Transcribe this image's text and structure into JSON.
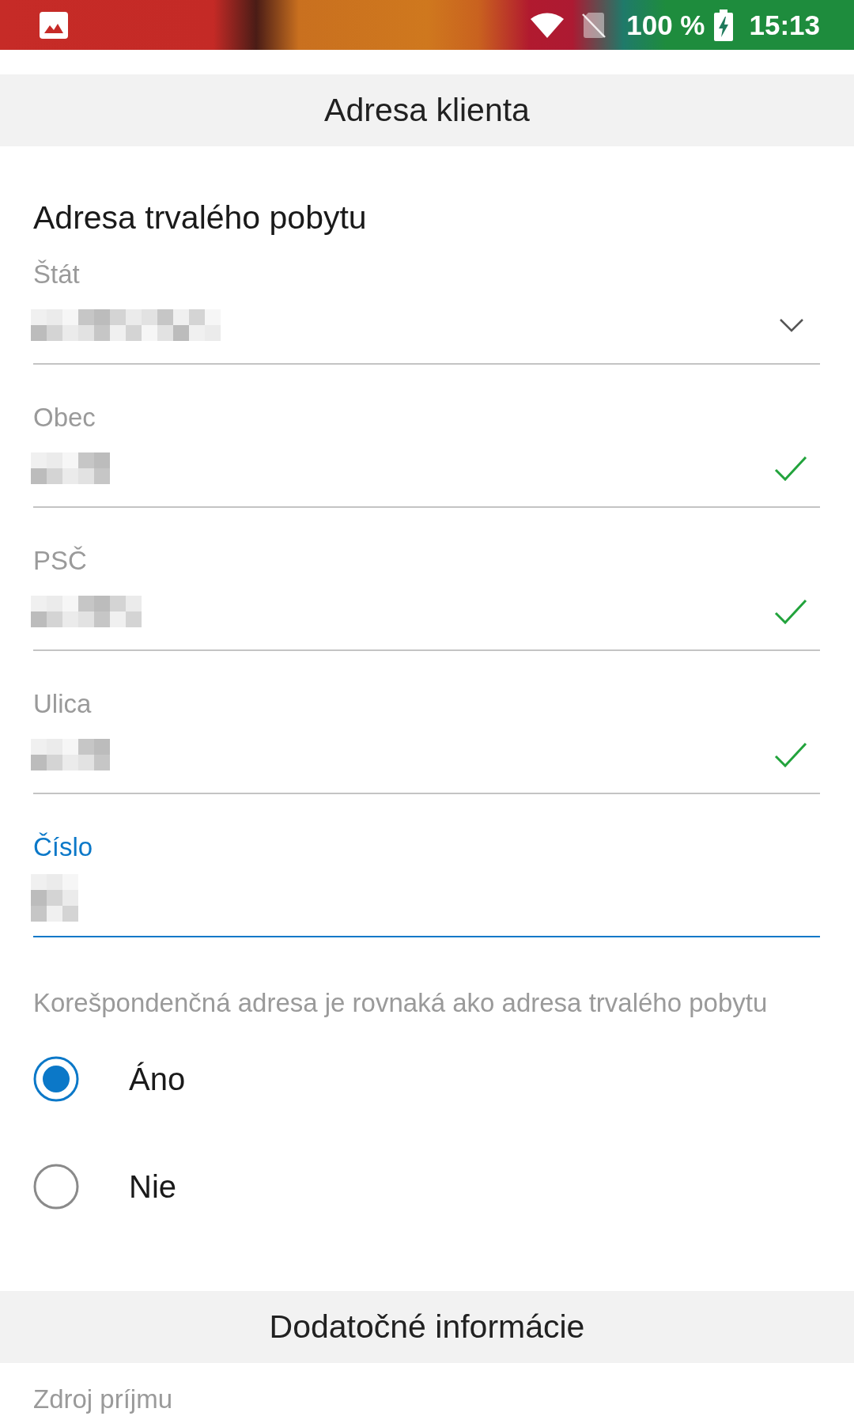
{
  "status_bar": {
    "battery": "100 %",
    "time": "15:13",
    "charging": true
  },
  "header": {
    "title": "Adresa klienta"
  },
  "permanent_address": {
    "title": "Adresa trvalého pobytu",
    "fields": [
      {
        "label": "Štát",
        "kind": "select",
        "redacted_value": {
          "kind": "long"
        },
        "valid": false,
        "focused": false
      },
      {
        "label": "Obec",
        "kind": "text",
        "redacted_value": {
          "kind": "short"
        },
        "valid": true,
        "focused": false
      },
      {
        "label": "PSČ",
        "kind": "text",
        "redacted_value": {
          "kind": "medium"
        },
        "valid": true,
        "focused": false
      },
      {
        "label": "Ulica",
        "kind": "text",
        "redacted_value": {
          "kind": "short"
        },
        "valid": true,
        "focused": false
      },
      {
        "label": "Číslo",
        "kind": "text",
        "redacted_value": {
          "kind": "tiny"
        },
        "valid": false,
        "focused": true
      }
    ]
  },
  "correspondence": {
    "question": "Korešpondenčná adresa je rovnaká ako adresa trvalého pobytu",
    "options": [
      {
        "label": "Áno",
        "selected": true
      },
      {
        "label": "Nie",
        "selected": false
      }
    ]
  },
  "additional_info": {
    "title": "Dodatočné informácie",
    "fields": [
      {
        "label": "Zdroj príjmu"
      }
    ]
  }
}
